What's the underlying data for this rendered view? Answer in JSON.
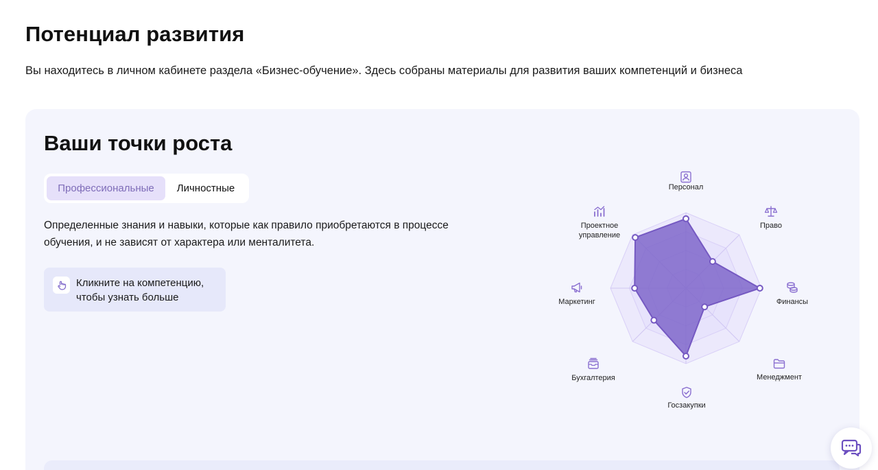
{
  "page": {
    "title": "Потенциал развития",
    "subtitle": "Вы находитесь в личном кабинете раздела «Бизнес-обучение». Здесь собраны материалы для развития ваших компетенций и бизнеса"
  },
  "growth": {
    "title": "Ваши точки роста",
    "tabs": [
      {
        "label": "Профессиональные",
        "active": true
      },
      {
        "label": "Личностные",
        "active": false
      }
    ],
    "description": "Определенные знания и навыки, которые как правило приобретаются в процессе обучения, и не зависят от характера или менталитета.",
    "hint": {
      "icon": "hand-pointer-icon",
      "text": "Кликните на компетенцию, чтобы узнать больше"
    }
  },
  "chart_data": {
    "type": "radar",
    "categories": [
      "Персонал",
      "Право",
      "Финансы",
      "Менеджмент",
      "Госзакупки",
      "Бухгалтерия",
      "Маркетинг",
      "Проектное управление"
    ],
    "category_icons": [
      "personnel-icon",
      "scales-icon",
      "coins-icon",
      "folder-icon",
      "shield-check-icon",
      "wallet-icon",
      "megaphone-icon",
      "chart-icon"
    ],
    "values": [
      0.92,
      0.5,
      0.98,
      0.35,
      0.9,
      0.6,
      0.68,
      0.95
    ],
    "range": [
      0,
      1
    ],
    "rings": 4,
    "colors": {
      "series_fill": "#7b63c8",
      "series_stroke": "#7559c2",
      "ring_fill": "#e5dffb",
      "icon": "#8a6fd0"
    }
  },
  "chat": {
    "icon": "chat-icon"
  }
}
